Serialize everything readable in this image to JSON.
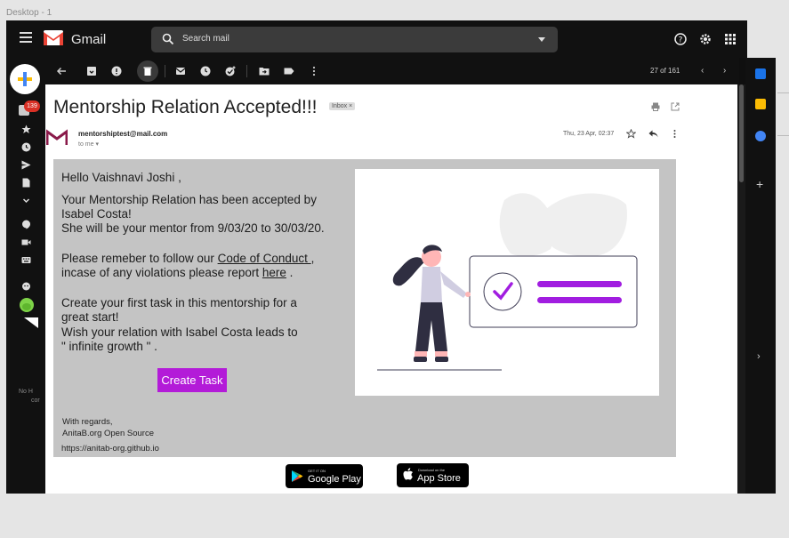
{
  "frame": {
    "label": "Desktop - 1"
  },
  "topbar": {
    "app_name": "Gmail",
    "search_placeholder": "Search mail",
    "icons": [
      "hamburger-icon",
      "help-icon",
      "gear-icon",
      "apps-grid-icon",
      "avatar"
    ]
  },
  "sidebar": {
    "unread_badge": "139",
    "footer_text_1": "No H",
    "footer_text_2": "cor"
  },
  "toolbar": {
    "pager": "27 of 161"
  },
  "message": {
    "subject": "Mentorship Relation Accepted!!!",
    "label_chip": "Inbox ×",
    "sender": "mentorshiptest@mail.com",
    "to_me": "to me ▾",
    "date": "Thu, 23 Apr, 02:37"
  },
  "email_body": {
    "greeting": "Hello Vaishnavi Joshi ,",
    "p1_line1": "Your Mentorship Relation has been accepted by",
    "p1_line2": "Isabel Costa!",
    "p1_line3": "She will be your mentor from 9/03/20 to 30/03/20.",
    "p2_prefix": "Please remeber to follow our ",
    "p2_link_coc": "Code of Conduct ",
    "p2_suffix": " ,",
    "p2_line2_prefix": "incase of any violations please report ",
    "p2_link_here": "here",
    "p2_line2_suffix": " .",
    "p3_line1": "Create your first task in this mentorship for a",
    "p3_line2": "great start!",
    "p3_line3": "Wish your relation with Isabel Costa leads to",
    "p3_line4": "\" infinite growth \" .",
    "cta": "Create Task",
    "regards": "With regards,",
    "org": "AnitaB.org Open Source",
    "url": "https://anitab-org.github.io"
  },
  "stores": {
    "google_small": "GET IT ON",
    "google_large": "Google Play",
    "apple_small": "Download on the",
    "apple_large": "App Store"
  },
  "colors": {
    "accent": "#b31bd8",
    "card_bg": "#c4c4c4",
    "dark_ui": "#111111",
    "check_purple": "#a11de0",
    "avatar_green": "#7ed348"
  }
}
